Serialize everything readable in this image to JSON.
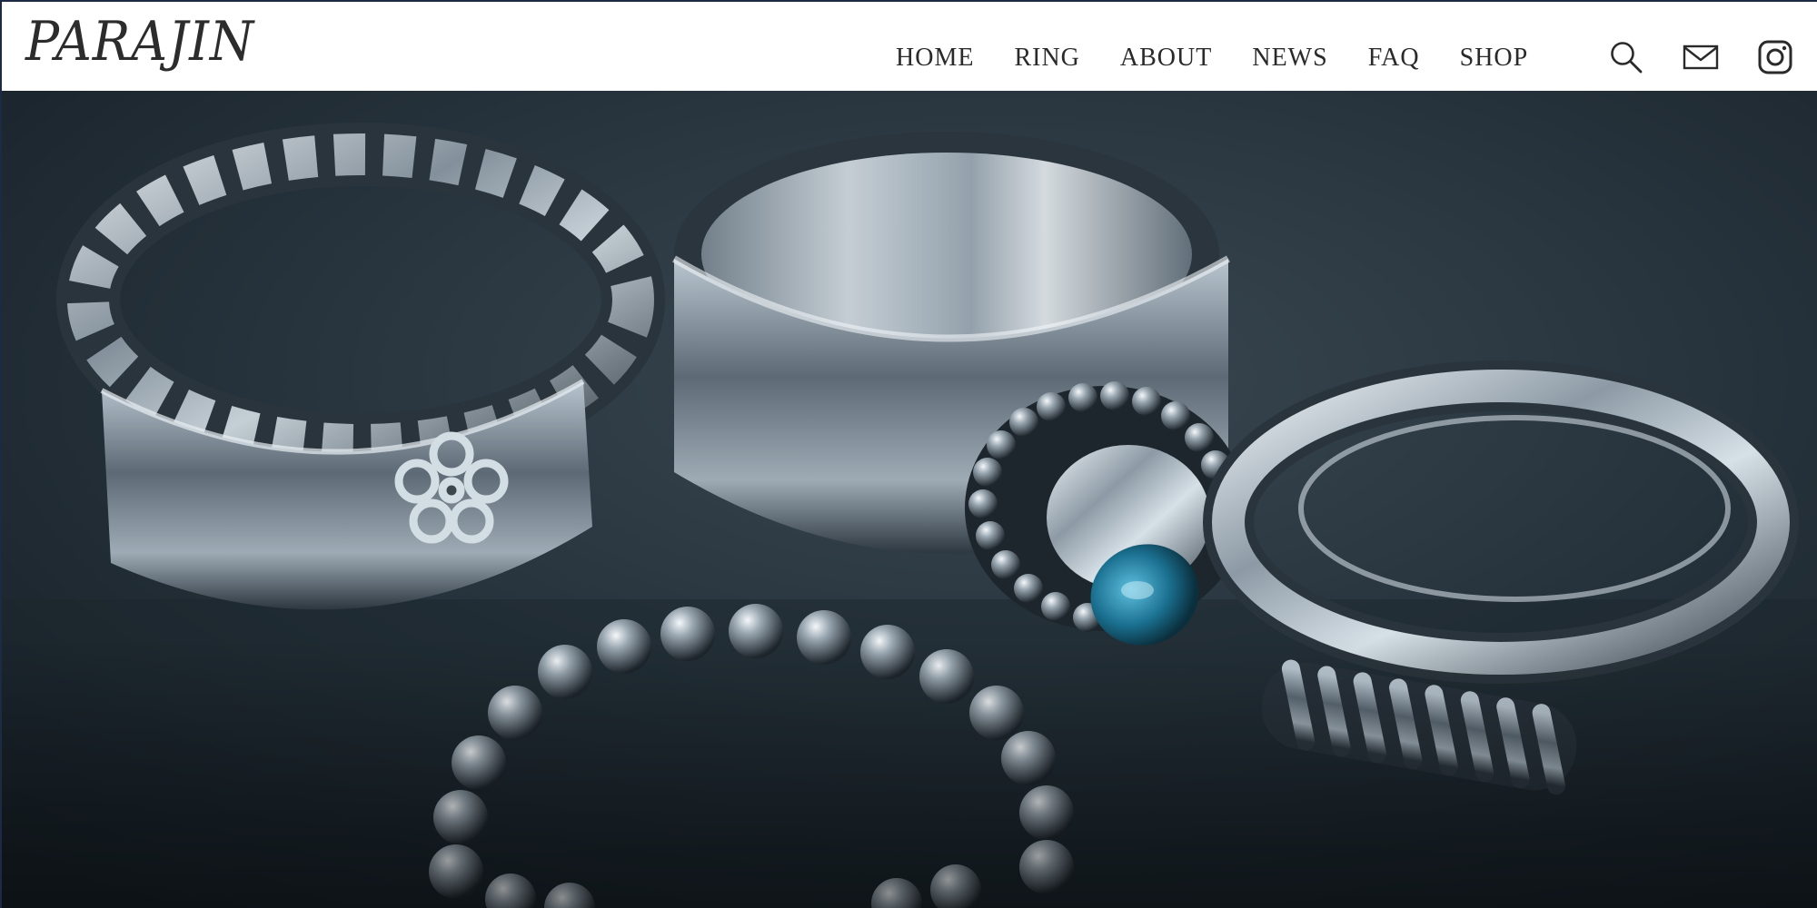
{
  "brand": {
    "logo_text": "PARAJIN"
  },
  "nav": {
    "items": [
      {
        "label": "HOME"
      },
      {
        "label": "RING"
      },
      {
        "label": "ABOUT"
      },
      {
        "label": "NEWS"
      },
      {
        "label": "FAQ"
      },
      {
        "label": "SHOP"
      }
    ]
  },
  "header_icons": [
    {
      "name": "search-icon"
    },
    {
      "name": "mail-icon"
    },
    {
      "name": "instagram-icon"
    }
  ],
  "hero": {
    "image_subject": "silver-rings-photo",
    "colors": {
      "background": "#1f2a33",
      "silver": "#c9d4dc",
      "stone": "#1a6f8f"
    }
  }
}
